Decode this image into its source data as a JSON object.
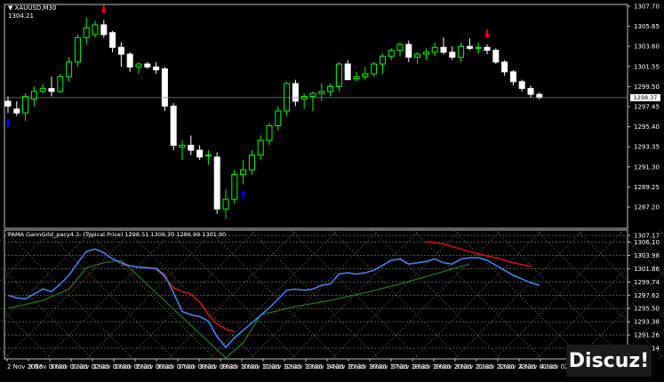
{
  "window": {
    "title": "XAUUSD,M30",
    "price_readout": "1304.21",
    "indicator_title": "PAMA GannGrid_pacy4.3: (Typical Price) 1298.51 1306.30 1286.99 1301.90",
    "current_price": "1298.37"
  },
  "watermark": {
    "text": "Discuz!"
  },
  "colors": {
    "background": "#000000",
    "bull_candle": "#00ff00",
    "bear_candle": "#ffffff",
    "sell_arrow": "#ff0000",
    "buy_arrow": "#0000ff",
    "indicator_blue": "#3c8cff",
    "indicator_red": "#e01010",
    "indicator_green": "#208020",
    "grid": "#a0a0a0"
  },
  "chart_data": {
    "type": "candlestick",
    "symbol": "XAUUSD",
    "timeframe": "M30",
    "price_axis_ticks": [
      "1307.70",
      "1305.65",
      "1303.60",
      "1301.55",
      "1299.50",
      "1297.45",
      "1295.40",
      "1293.35",
      "1291.30",
      "1289.25",
      "1287.20"
    ],
    "indicator_axis_ticks": [
      "1307.17",
      "1306.10",
      "1303.98",
      "1301.86",
      "1299.74",
      "1297.62",
      "1295.50",
      "1293.38",
      "1291.26",
      "1289.14"
    ],
    "time_axis_labels": [
      "2 Nov 2016",
      "3 Nov 00:30",
      "3 Nov 01:30",
      "3 Nov 02:30",
      "3 Nov 03:30",
      "3 Nov 05:30",
      "3 Nov 06:30",
      "3 Nov 07:30",
      "3 Nov 08:30",
      "3 Nov 09:30",
      "3 Nov 10:30",
      "3 Nov 11:30",
      "3 Nov 12:30",
      "3 Nov 13:30",
      "3 Nov 14:30",
      "3 Nov 15:30",
      "3 Nov 16:30",
      "3 Nov 17:30",
      "3 Nov 18:30",
      "3 Nov 19:30",
      "3 Nov 20:30",
      "3 Nov 21:30",
      "3 Nov 22:30",
      "3 Nov 23:30",
      "4 Nov 01:30",
      "4 Nov 02:30"
    ],
    "candles": [
      {
        "o": 1298.0,
        "h": 1298.5,
        "l": 1296.8,
        "c": 1297.5
      },
      {
        "o": 1297.2,
        "h": 1298.0,
        "l": 1296.5,
        "c": 1296.8
      },
      {
        "o": 1296.8,
        "h": 1298.8,
        "l": 1296.0,
        "c": 1298.5
      },
      {
        "o": 1298.2,
        "h": 1299.5,
        "l": 1297.5,
        "c": 1299.0
      },
      {
        "o": 1299.0,
        "h": 1299.8,
        "l": 1298.8,
        "c": 1299.3
      },
      {
        "o": 1299.3,
        "h": 1300.5,
        "l": 1298.5,
        "c": 1299.0
      },
      {
        "o": 1299.0,
        "h": 1300.8,
        "l": 1298.8,
        "c": 1300.5
      },
      {
        "o": 1300.5,
        "h": 1302.5,
        "l": 1300.0,
        "c": 1302.0
      },
      {
        "o": 1302.0,
        "h": 1304.8,
        "l": 1301.5,
        "c": 1304.5
      },
      {
        "o": 1304.5,
        "h": 1306.6,
        "l": 1303.8,
        "c": 1305.5
      },
      {
        "o": 1304.8,
        "h": 1306.2,
        "l": 1304.5,
        "c": 1305.8
      },
      {
        "o": 1305.8,
        "h": 1306.3,
        "l": 1304.5,
        "c": 1304.8
      },
      {
        "o": 1305.0,
        "h": 1305.2,
        "l": 1303.0,
        "c": 1303.5
      },
      {
        "o": 1303.5,
        "h": 1304.0,
        "l": 1301.5,
        "c": 1302.8
      },
      {
        "o": 1302.8,
        "h": 1303.0,
        "l": 1301.0,
        "c": 1301.5
      },
      {
        "o": 1301.5,
        "h": 1302.0,
        "l": 1300.8,
        "c": 1301.8
      },
      {
        "o": 1301.8,
        "h": 1302.0,
        "l": 1301.3,
        "c": 1301.5
      },
      {
        "o": 1301.5,
        "h": 1302.0,
        "l": 1300.8,
        "c": 1301.2
      },
      {
        "o": 1301.3,
        "h": 1301.5,
        "l": 1297.0,
        "c": 1297.5
      },
      {
        "o": 1297.5,
        "h": 1297.8,
        "l": 1293.0,
        "c": 1293.5
      },
      {
        "o": 1293.3,
        "h": 1294.0,
        "l": 1292.0,
        "c": 1293.5
      },
      {
        "o": 1293.5,
        "h": 1294.5,
        "l": 1292.5,
        "c": 1293.0
      },
      {
        "o": 1293.0,
        "h": 1293.5,
        "l": 1292.0,
        "c": 1292.3
      },
      {
        "o": 1292.5,
        "h": 1293.0,
        "l": 1291.5,
        "c": 1292.5
      },
      {
        "o": 1292.3,
        "h": 1292.8,
        "l": 1286.5,
        "c": 1287.0
      },
      {
        "o": 1287.0,
        "h": 1289.0,
        "l": 1286.0,
        "c": 1288.0
      },
      {
        "o": 1288.0,
        "h": 1291.0,
        "l": 1287.5,
        "c": 1290.5
      },
      {
        "o": 1290.5,
        "h": 1292.0,
        "l": 1289.5,
        "c": 1291.0
      },
      {
        "o": 1291.0,
        "h": 1293.0,
        "l": 1290.5,
        "c": 1292.5
      },
      {
        "o": 1292.5,
        "h": 1294.5,
        "l": 1292.0,
        "c": 1294.0
      },
      {
        "o": 1294.0,
        "h": 1295.8,
        "l": 1293.5,
        "c": 1295.5
      },
      {
        "o": 1295.5,
        "h": 1297.5,
        "l": 1295.0,
        "c": 1297.0
      },
      {
        "o": 1297.0,
        "h": 1300.0,
        "l": 1296.5,
        "c": 1299.8
      },
      {
        "o": 1299.8,
        "h": 1300.2,
        "l": 1297.5,
        "c": 1298.0
      },
      {
        "o": 1298.2,
        "h": 1298.8,
        "l": 1297.2,
        "c": 1298.5
      },
      {
        "o": 1298.5,
        "h": 1299.0,
        "l": 1297.0,
        "c": 1298.8
      },
      {
        "o": 1298.8,
        "h": 1299.8,
        "l": 1298.0,
        "c": 1299.0
      },
      {
        "o": 1299.0,
        "h": 1299.8,
        "l": 1298.5,
        "c": 1299.5
      },
      {
        "o": 1299.5,
        "h": 1302.0,
        "l": 1299.0,
        "c": 1301.8
      },
      {
        "o": 1301.8,
        "h": 1302.2,
        "l": 1300.5,
        "c": 1300.2
      },
      {
        "o": 1300.3,
        "h": 1301.0,
        "l": 1300.0,
        "c": 1300.5
      },
      {
        "o": 1300.5,
        "h": 1301.5,
        "l": 1300.2,
        "c": 1300.8
      },
      {
        "o": 1300.8,
        "h": 1302.0,
        "l": 1300.5,
        "c": 1301.8
      },
      {
        "o": 1301.8,
        "h": 1302.8,
        "l": 1300.8,
        "c": 1302.6
      },
      {
        "o": 1302.6,
        "h": 1303.4,
        "l": 1302.2,
        "c": 1303.2
      },
      {
        "o": 1303.2,
        "h": 1304.0,
        "l": 1302.6,
        "c": 1303.8
      },
      {
        "o": 1303.8,
        "h": 1304.2,
        "l": 1302.0,
        "c": 1302.5
      },
      {
        "o": 1302.5,
        "h": 1303.0,
        "l": 1301.8,
        "c": 1302.8
      },
      {
        "o": 1302.8,
        "h": 1303.4,
        "l": 1302.2,
        "c": 1303.0
      },
      {
        "o": 1303.0,
        "h": 1304.0,
        "l": 1302.6,
        "c": 1303.5
      },
      {
        "o": 1303.5,
        "h": 1304.5,
        "l": 1302.8,
        "c": 1303.0
      },
      {
        "o": 1303.0,
        "h": 1303.6,
        "l": 1302.2,
        "c": 1302.5
      },
      {
        "o": 1302.5,
        "h": 1304.0,
        "l": 1302.0,
        "c": 1303.6
      },
      {
        "o": 1303.6,
        "h": 1304.4,
        "l": 1303.2,
        "c": 1303.4
      },
      {
        "o": 1303.4,
        "h": 1304.0,
        "l": 1302.8,
        "c": 1303.5
      },
      {
        "o": 1303.5,
        "h": 1303.8,
        "l": 1302.8,
        "c": 1303.2
      },
      {
        "o": 1303.2,
        "h": 1303.4,
        "l": 1301.8,
        "c": 1302.0
      },
      {
        "o": 1302.0,
        "h": 1302.2,
        "l": 1300.6,
        "c": 1301.0
      },
      {
        "o": 1301.0,
        "h": 1301.2,
        "l": 1299.6,
        "c": 1300.0
      },
      {
        "o": 1300.0,
        "h": 1300.2,
        "l": 1299.0,
        "c": 1299.3
      },
      {
        "o": 1299.3,
        "h": 1299.6,
        "l": 1298.4,
        "c": 1298.7
      },
      {
        "o": 1298.7,
        "h": 1298.9,
        "l": 1298.2,
        "c": 1298.37
      }
    ],
    "sell_arrows": [
      11,
      55
    ],
    "buy_arrows": [
      0,
      27
    ],
    "indicator_blue": [
      1297.6,
      1297.2,
      1297.0,
      1297.8,
      1298.6,
      1298.2,
      1299.4,
      1300.8,
      1302.8,
      1304.6,
      1305.0,
      1304.4,
      1303.4,
      1302.8,
      1302.3,
      1302.1,
      1302.0,
      1301.9,
      1300.8,
      1298.0,
      1295.0,
      1294.5,
      1294.2,
      1293.5,
      1291.0,
      1289.3,
      1290.8,
      1292.0,
      1293.2,
      1294.4,
      1295.6,
      1297.0,
      1298.4,
      1298.6,
      1298.4,
      1298.6,
      1299.2,
      1299.4,
      1301.0,
      1301.2,
      1301.0,
      1301.2,
      1301.6,
      1302.4,
      1303.2,
      1303.4,
      1302.6,
      1302.8,
      1303.0,
      1303.4,
      1302.8,
      1302.6,
      1303.4,
      1303.6,
      1303.6,
      1303.2,
      1302.4,
      1301.6,
      1300.8,
      1300.2,
      1299.6,
      1299.2
    ],
    "indicator_red": [
      [
        13,
        1302.5
      ],
      [
        14,
        1302.3
      ],
      [
        15,
        1302.1
      ],
      [
        16,
        1302.0
      ],
      [
        17,
        1301.8
      ],
      [
        18,
        1300.5
      ],
      [
        19,
        1298.8
      ],
      [
        20,
        1298.2
      ],
      [
        21,
        1297.8
      ],
      [
        22,
        1296.5
      ],
      [
        23,
        1294.5
      ],
      [
        24,
        1293.0
      ],
      [
        25,
        1292.2
      ],
      [
        26,
        1291.8
      ],
      [
        48,
        1306.2
      ],
      [
        50,
        1305.8
      ],
      [
        52,
        1305.0
      ],
      [
        54,
        1304.2
      ],
      [
        56,
        1303.6
      ],
      [
        58,
        1302.8
      ],
      [
        60,
        1302.2
      ]
    ],
    "indicator_green": [
      [
        0,
        1295.5
      ],
      [
        4,
        1296.8
      ],
      [
        7,
        1298.6
      ],
      [
        9,
        1302.0
      ],
      [
        11,
        1302.8
      ],
      [
        13,
        1303.2
      ],
      [
        25,
        1287.6
      ],
      [
        27,
        1290.0
      ],
      [
        29,
        1294.5
      ],
      [
        33,
        1295.8
      ],
      [
        37,
        1296.8
      ],
      [
        41,
        1298.0
      ],
      [
        45,
        1299.4
      ],
      [
        49,
        1301.0
      ],
      [
        53,
        1302.6
      ]
    ]
  }
}
